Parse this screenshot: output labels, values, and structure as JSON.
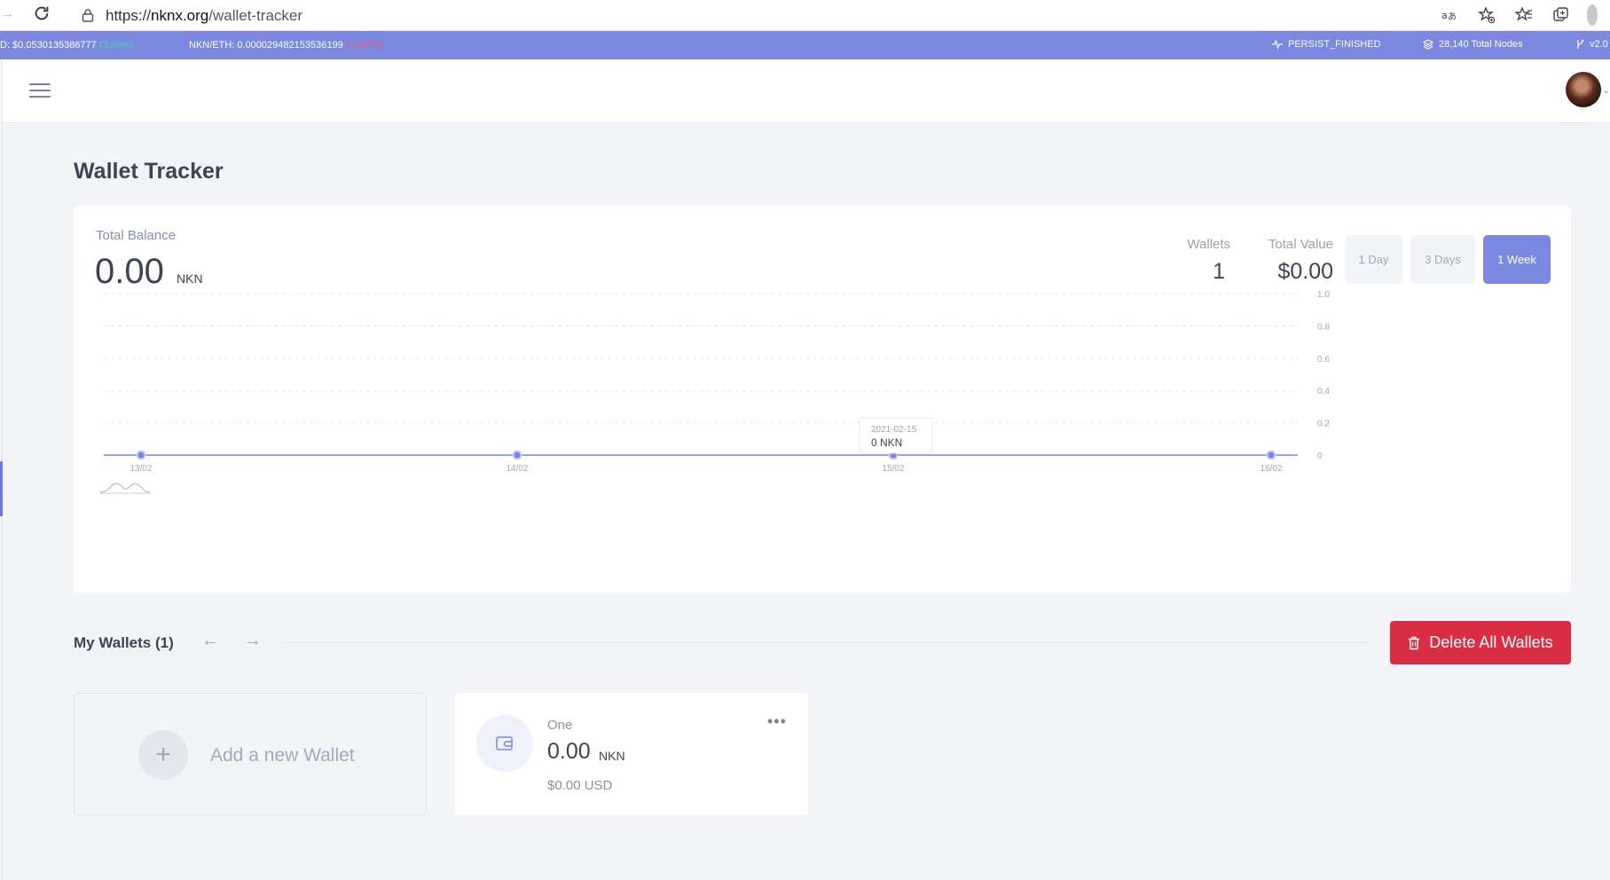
{
  "browser": {
    "url_prefix": "https://",
    "url_host": "nknx.org",
    "url_path": "/wallet-tracker"
  },
  "ticker": {
    "usd_price": "D: $0.0530135386777",
    "usd_change": "(3.66%)",
    "eth_price": "NKN/ETH: 0.000029482153536199",
    "eth_change": "(-1.07%)",
    "status": "PERSIST_FINISHED",
    "nodes": "28,140 Total Nodes",
    "version": "v2.0"
  },
  "colors": {
    "accent": "#7b88e0",
    "danger": "#d92d43",
    "up": "#4cd3a0",
    "down": "#ff4d6d"
  },
  "page": {
    "title": "Wallet Tracker"
  },
  "summary": {
    "total_balance_label": "Total Balance",
    "total_balance_value": "0.00",
    "total_balance_unit": "NKN",
    "wallets_label": "Wallets",
    "wallets_value": "1",
    "total_value_label": "Total Value",
    "total_value_value": "$0.00"
  },
  "ranges": [
    {
      "label": "1 Day",
      "active": false
    },
    {
      "label": "3 Days",
      "active": false
    },
    {
      "label": "1 Week",
      "active": true
    }
  ],
  "chart_data": {
    "type": "line",
    "x": [
      "13/02",
      "14/02",
      "15/02",
      "16/02"
    ],
    "series": [
      {
        "values": [
          0,
          0,
          0,
          0
        ]
      }
    ],
    "y_ticks": [
      "0",
      "0.2",
      "0.4",
      "0.6",
      "0.8",
      "1.0"
    ],
    "ylim": [
      0,
      1
    ],
    "grid": true,
    "tooltip": {
      "date": "2021-02-15",
      "value": "0 NKN"
    }
  },
  "wallets_section": {
    "title": "My Wallets (1)",
    "prev_icon": "arrow-left-icon",
    "next_icon": "arrow-right-icon",
    "delete_label": "Delete All Wallets",
    "add_label": "Add a new Wallet"
  },
  "wallets": [
    {
      "name": "One",
      "balance": "0.00",
      "unit": "NKN",
      "usd": "$0.00 USD",
      "menu": "•••"
    }
  ]
}
